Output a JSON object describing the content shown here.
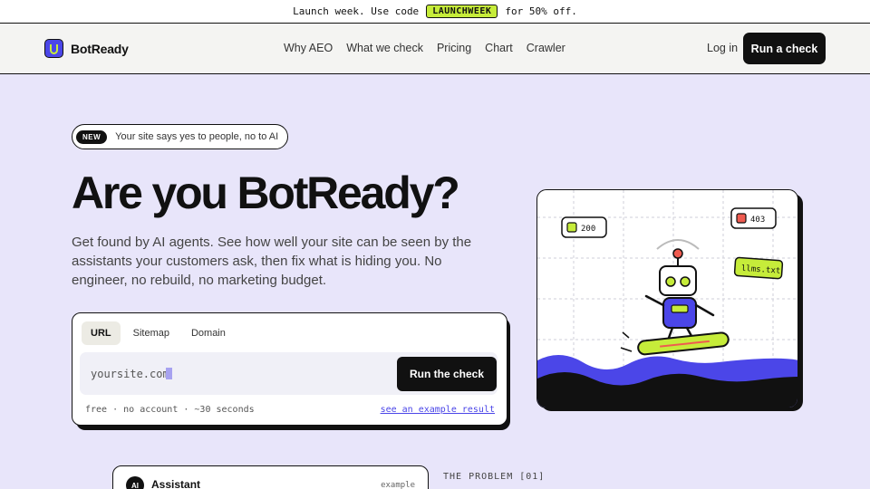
{
  "promo": {
    "before": "Launch week. Use code",
    "code": "LAUNCHWEEK",
    "after": "for 50% off."
  },
  "nav": {
    "brand": "BotReady",
    "links": [
      "Why AEO",
      "What we check",
      "Pricing",
      "Chart",
      "Crawler"
    ],
    "login": "Log in",
    "cta": "Run a check"
  },
  "hero": {
    "badge": "NEW",
    "badge_text": "Your site says yes to people, no to AI",
    "headline": "Are you BotReady?",
    "subheadline": "Get found by AI agents. See how well your site can be seen by the assistants your customers ask, then fix what is hiding you. No engineer, no rebuild, no marketing budget."
  },
  "check": {
    "tabs": [
      "URL",
      "Sitemap",
      "Domain"
    ],
    "active_tab": "URL",
    "input_value": "yoursite.com",
    "button": "Run the check",
    "meta": "free · no account · ~30 seconds",
    "example_link": "see an example result"
  },
  "illustration": {
    "badge_ok": "200",
    "badge_blocked": "403",
    "file_tag": "llms.txt",
    "colors": {
      "accent": "#4b46e8",
      "lime": "#c6ec3a",
      "red": "#ef5b50"
    }
  },
  "bottom": {
    "assistant_icon": "AI",
    "assistant_title": "Assistant",
    "assistant_tag": "example",
    "problem_label": "THE PROBLEM [01]"
  }
}
